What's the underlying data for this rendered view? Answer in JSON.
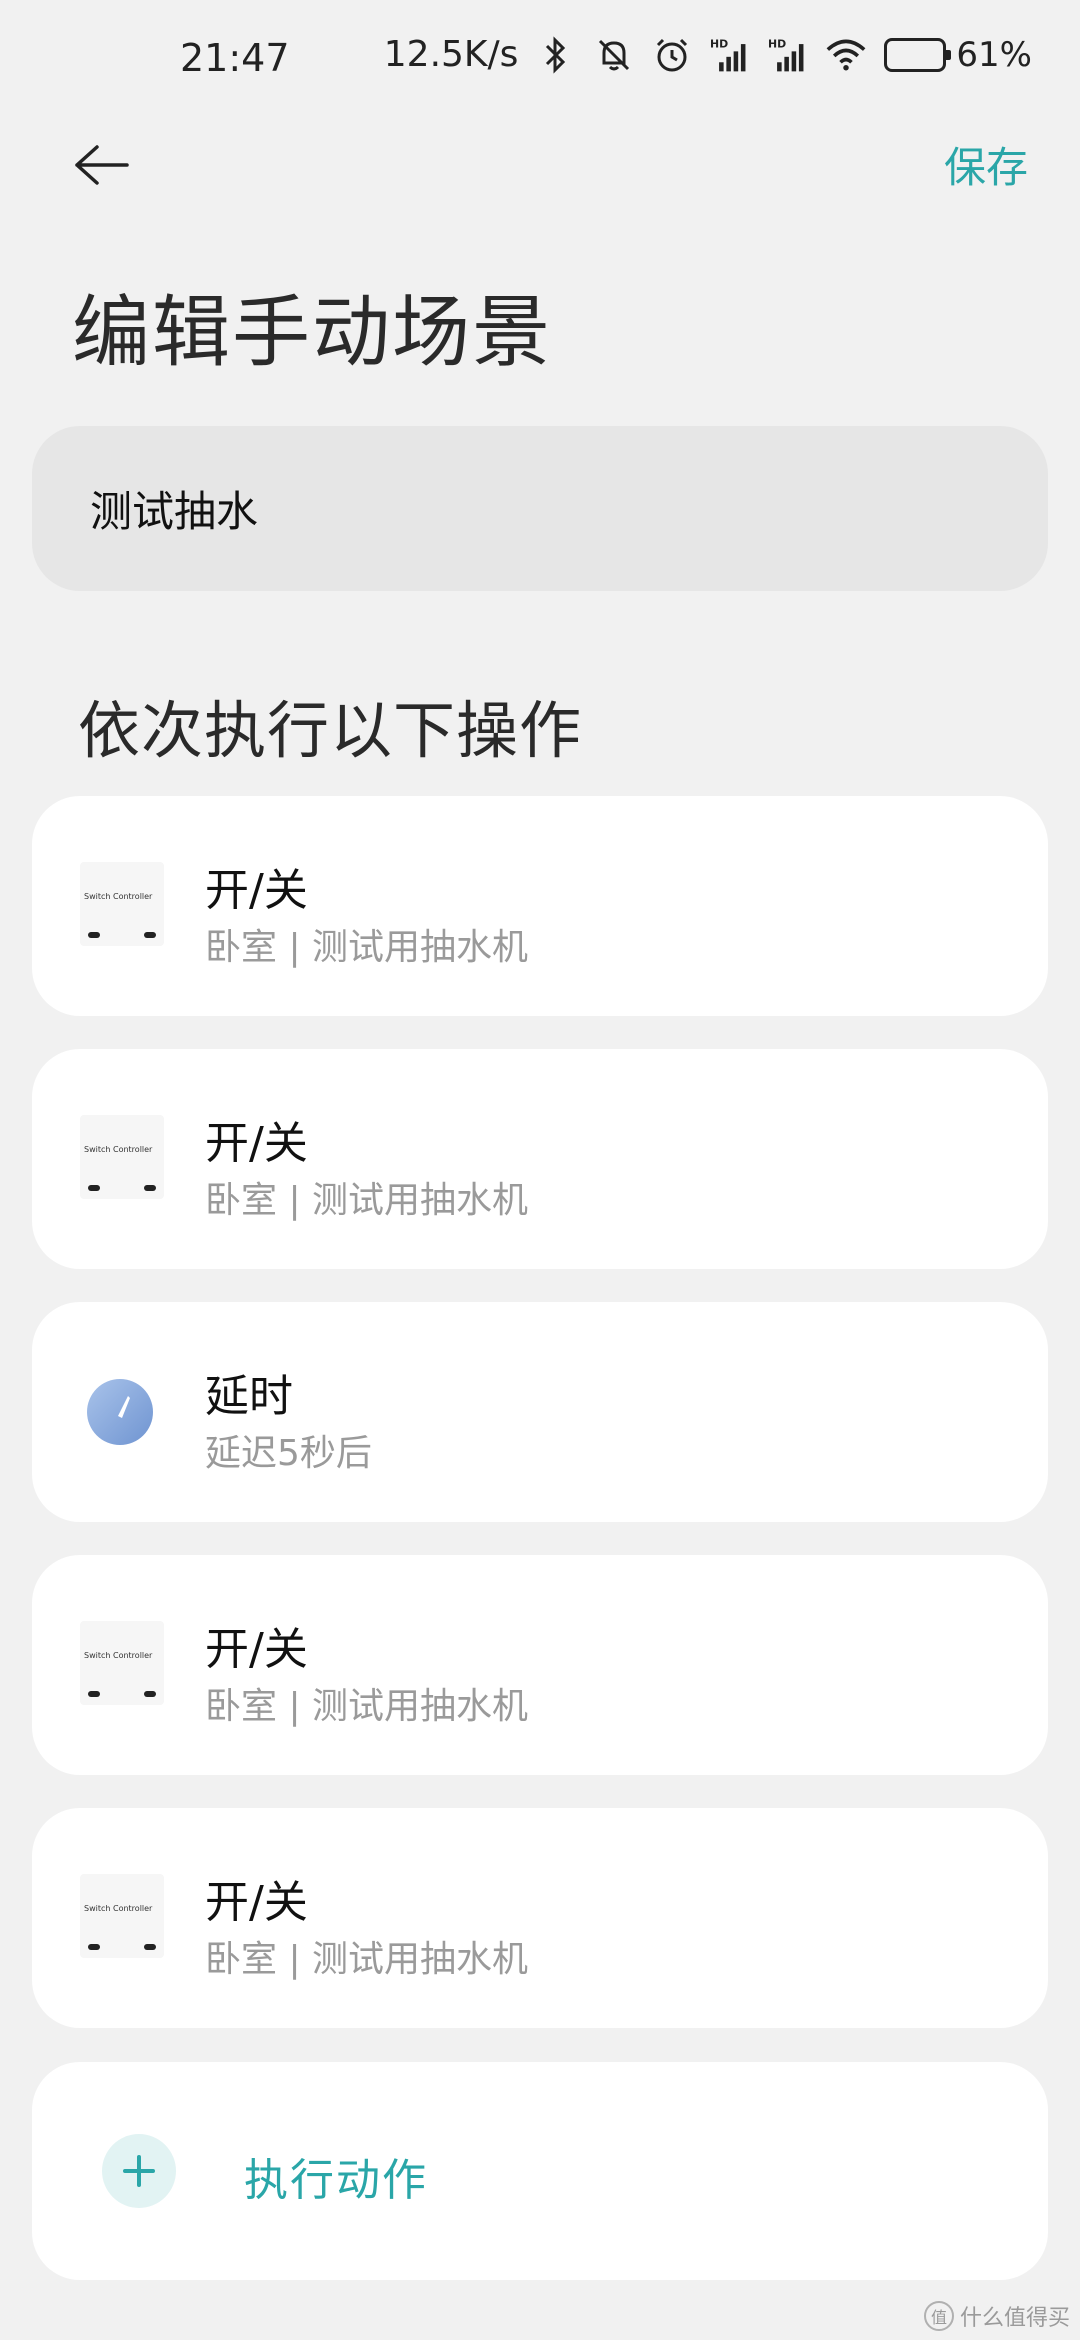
{
  "status_bar": {
    "time": "21:47",
    "net_speed": "12.5K/s",
    "battery": "61%",
    "icons": [
      "bluetooth-icon",
      "mute-icon",
      "alarm-icon",
      "hd-signal-icon",
      "hd-signal-icon",
      "wifi-icon",
      "battery-icon"
    ]
  },
  "header": {
    "save_label": "保存",
    "title": "编辑手动场景"
  },
  "scene": {
    "name_value": "测试抽水"
  },
  "section": {
    "title": "依次执行以下操作"
  },
  "actions": [
    {
      "title": "开/关",
      "subtitle": "卧室 | 测试用抽水机",
      "thumb_text": "Switch Controller"
    },
    {
      "title": "开/关",
      "subtitle": "卧室 | 测试用抽水机",
      "thumb_text": "Switch Controller"
    },
    {
      "title": "延时",
      "subtitle": "延迟5秒后"
    },
    {
      "title": "开/关",
      "subtitle": "卧室 | 测试用抽水机",
      "thumb_text": "Switch Controller"
    },
    {
      "title": "开/关",
      "subtitle": "卧室 | 测试用抽水机",
      "thumb_text": "Switch Controller"
    }
  ],
  "add_action": {
    "label": "执行动作"
  },
  "watermark": {
    "badge": "值",
    "text": "什么值得买"
  },
  "colors": {
    "accent": "#2aa6a8",
    "background": "#f1f1f1",
    "timer_icon": "#86a9dd"
  }
}
